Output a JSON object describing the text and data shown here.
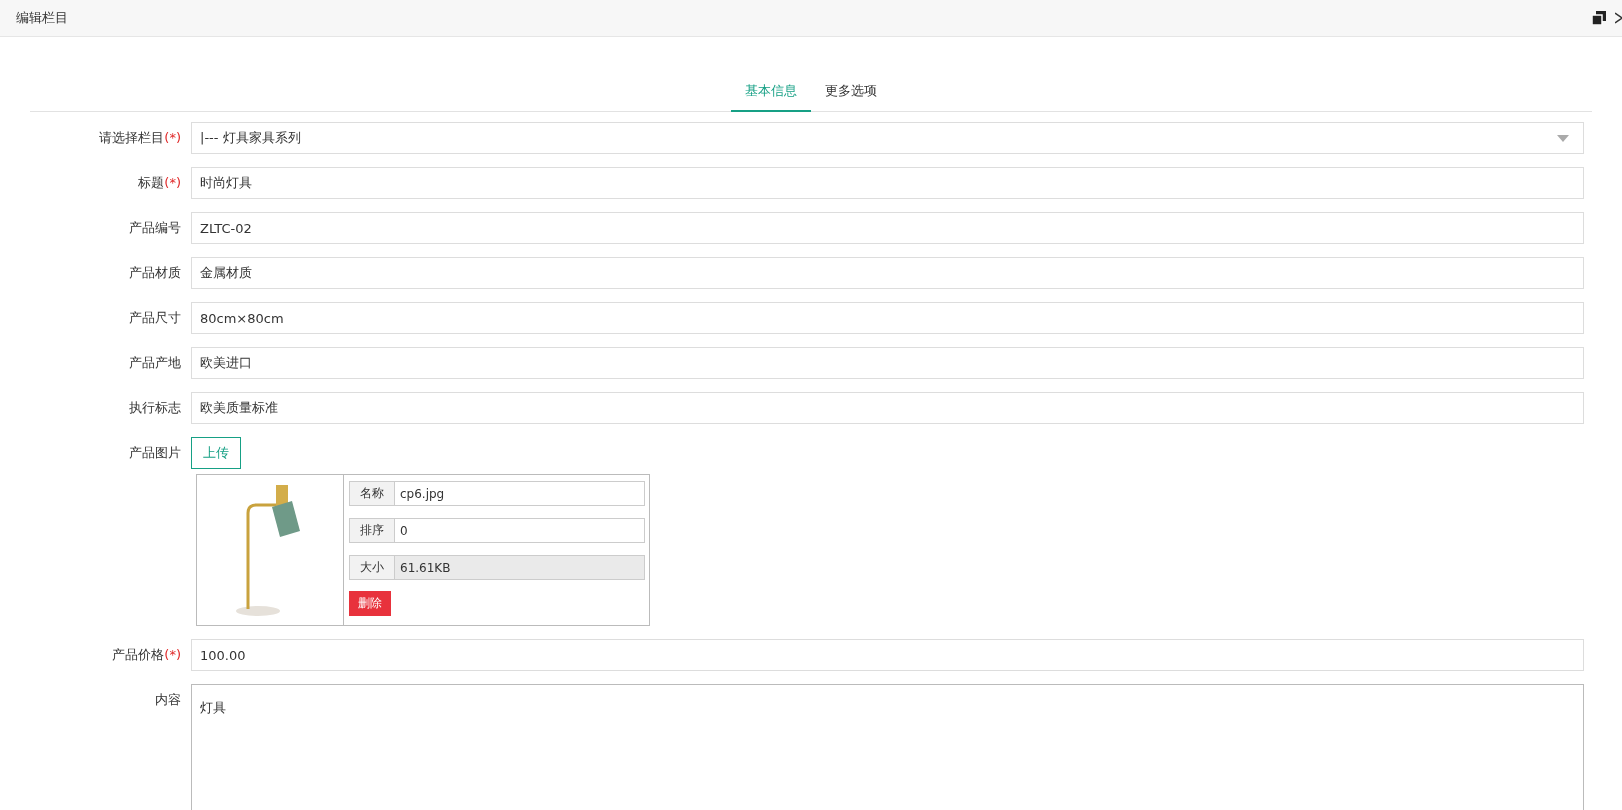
{
  "window": {
    "title": "编辑栏目"
  },
  "tabs": [
    {
      "label": "基本信息",
      "selected": true
    },
    {
      "label": "更多选项",
      "selected": false
    }
  ],
  "fields": [
    {
      "kind": "select",
      "label": "请选择栏目",
      "required": true,
      "value": "|--- 灯具家具系列"
    },
    {
      "kind": "text",
      "label": "标题",
      "required": true,
      "value": "时尚灯具"
    },
    {
      "kind": "text",
      "label": "产品编号",
      "required": false,
      "value": "ZLTC-02"
    },
    {
      "kind": "text",
      "label": "产品材质",
      "required": false,
      "value": "金属材质"
    },
    {
      "kind": "text",
      "label": "产品尺寸",
      "required": false,
      "value": "80cm×80cm"
    },
    {
      "kind": "text",
      "label": "产品产地",
      "required": false,
      "value": "欧美进口"
    },
    {
      "kind": "text",
      "label": "执行标志",
      "required": false,
      "value": "欧美质量标准"
    },
    {
      "kind": "upload",
      "label": "产品图片",
      "required": false,
      "button": "上传",
      "files": [
        {
          "meta": [
            {
              "label": "名称",
              "value": "cp6.jpg",
              "readonly": false
            },
            {
              "label": "排序",
              "value": "0",
              "readonly": false
            },
            {
              "label": "大小",
              "value": "61.61KB",
              "readonly": true
            }
          ],
          "delete": "删除"
        }
      ]
    },
    {
      "kind": "text",
      "label": "产品价格",
      "required": true,
      "value": "100.00"
    },
    {
      "kind": "textarea",
      "label": "内容",
      "required": false,
      "value": "灯具"
    }
  ],
  "required_mark": "(*)"
}
